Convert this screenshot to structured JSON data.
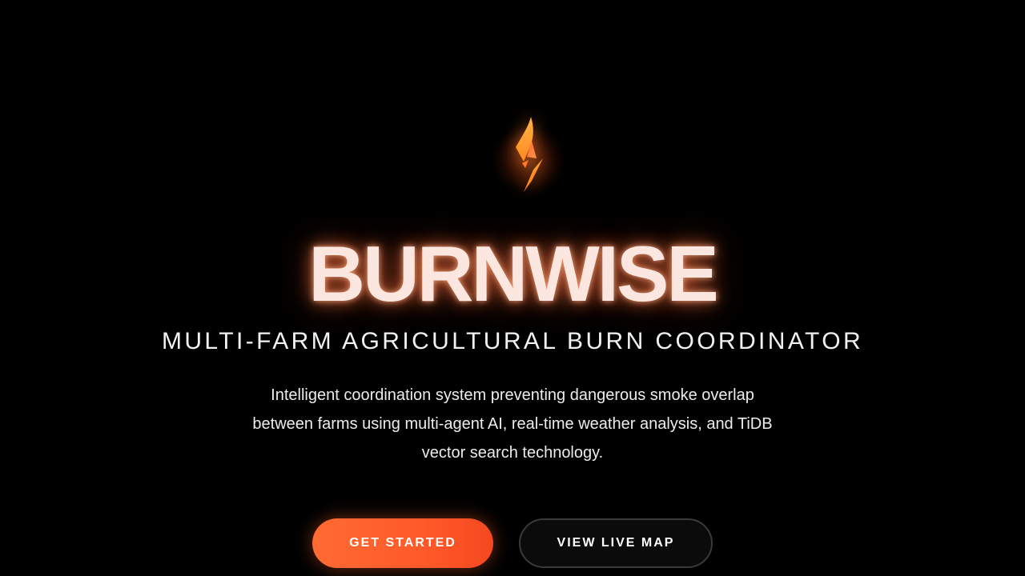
{
  "hero": {
    "logo_icon": "flame-icon",
    "brand": "BURNWISE",
    "tagline": "MULTI-FARM AGRICULTURAL BURN COORDINATOR",
    "description_lines": [
      "Intelligent coordination system preventing dangerous smoke overlap",
      "between farms using multi-agent AI, real-time weather analysis, and TiDB",
      "vector search technology."
    ]
  },
  "actions": {
    "primary_label": "GET STARTED",
    "secondary_label": "VIEW LIVE MAP"
  },
  "colors": {
    "background": "#000000",
    "accent": "#ff5a2a",
    "brand_text": "#fbe7df",
    "secondary_border": "#3a3a3a"
  }
}
